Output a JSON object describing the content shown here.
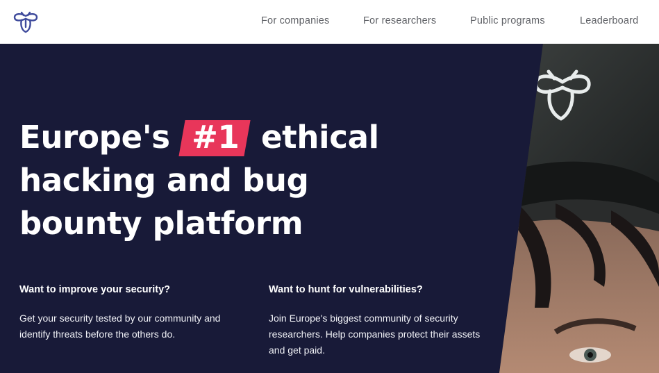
{
  "nav": {
    "links": [
      {
        "label": "For companies"
      },
      {
        "label": "For researchers"
      },
      {
        "label": "Public programs"
      },
      {
        "label": "Leaderboard"
      }
    ]
  },
  "hero": {
    "headline": {
      "line1_before": "Europe's",
      "badge": "#1",
      "line1_after": "ethical",
      "line2": "hacking and bug",
      "line3": "bounty platform"
    },
    "companies": {
      "title": "Want to improve your security?",
      "text": "Get your security tested by our community and identify threats before the others do."
    },
    "researchers": {
      "title": "Want to hunt for vulnerabilities?",
      "text": "Join Europe's biggest community of security researchers. Help companies protect their assets and get paid."
    }
  },
  "colors": {
    "hero_background": "#181a38",
    "accent": "#e8365a",
    "logo": "#3f4b9c",
    "nav_text": "#5f6166"
  },
  "icons": {
    "logo": "bee-logo-icon"
  }
}
